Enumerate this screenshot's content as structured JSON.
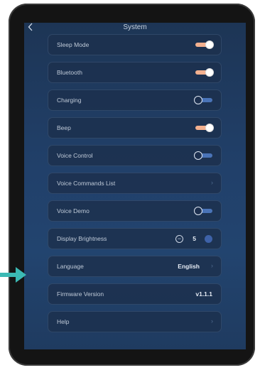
{
  "header": {
    "title": "System",
    "back_icon": "chevron-left-icon"
  },
  "settings": [
    {
      "label": "Sleep Mode",
      "control": "toggle",
      "state": "on"
    },
    {
      "label": "Bluetooth",
      "control": "toggle",
      "state": "on"
    },
    {
      "label": "Charging",
      "control": "toggle",
      "state": "off"
    },
    {
      "label": "Beep",
      "control": "toggle",
      "state": "on"
    },
    {
      "label": "Voice Control",
      "control": "toggle",
      "state": "off"
    },
    {
      "label": "Voice Commands List",
      "control": "chevron"
    },
    {
      "label": "Voice Demo",
      "control": "toggle",
      "state": "off"
    },
    {
      "label": "Display Brightness",
      "control": "stepper",
      "value": "5",
      "minus": "−",
      "plus": "+"
    },
    {
      "label": "Language",
      "control": "value-chevron",
      "value": "English"
    },
    {
      "label": "Firmware Version",
      "control": "value",
      "value": "v1.1.1"
    },
    {
      "label": "Help",
      "control": "chevron"
    }
  ],
  "colors": {
    "toggle_on": "#f2b08f",
    "toggle_off": "#4a74b8",
    "pointer_arrow": "#3bb9b4",
    "screen_bg": "#21406a"
  },
  "annotation": {
    "icon": "arrow-right-icon",
    "points_to": "Language"
  }
}
